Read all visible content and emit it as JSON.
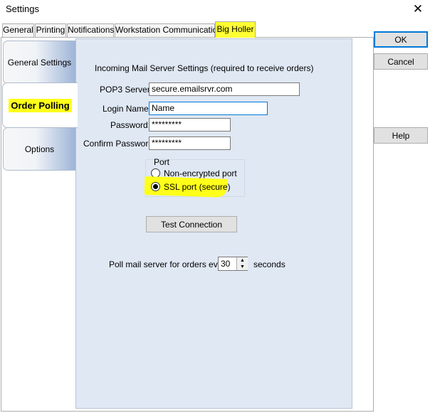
{
  "window": {
    "title": "Settings",
    "close_glyph": "✕"
  },
  "tabs": [
    {
      "label": "General"
    },
    {
      "label": "Printing"
    },
    {
      "label": "Notifications"
    },
    {
      "label": "Workstation Communication"
    },
    {
      "label": "Big Holler",
      "selected": true
    }
  ],
  "side_tabs": [
    {
      "label": "General Settings"
    },
    {
      "label": "Order Polling",
      "active": true
    },
    {
      "label": "Options"
    }
  ],
  "mail": {
    "heading": "Incoming Mail Server Settings (required to receive orders)",
    "pop3_label": "POP3 Server:",
    "pop3_value": "secure.emailsrvr.com",
    "login_label": "Login Name:",
    "login_value": "Name",
    "password_label": "Password:",
    "password_value": "*********",
    "confirm_label": "Confirm Password:",
    "confirm_value": "*********"
  },
  "port": {
    "group_label": "Port",
    "options": [
      {
        "label": "Non-encrypted port",
        "checked": false
      },
      {
        "label": "SSL port (secure)",
        "checked": true
      }
    ]
  },
  "test_button": "Test Connection",
  "poll": {
    "prefix": "Poll mail server for orders every",
    "value": "30",
    "suffix": "seconds"
  },
  "dialog_buttons": {
    "ok": "OK",
    "cancel": "Cancel",
    "help": "Help"
  },
  "colors": {
    "highlight": "#ffff1a",
    "panel": "#dfe8f3",
    "accent": "#0078d7"
  },
  "icons": {
    "close": "close-icon",
    "spin_up": "chevron-up-icon",
    "spin_down": "chevron-down-icon"
  }
}
